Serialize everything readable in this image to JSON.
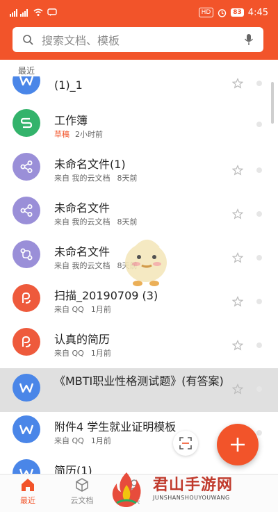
{
  "statusbar": {
    "hd_badge": "HD",
    "battery": "83",
    "time": "4:45"
  },
  "search": {
    "placeholder": "搜索文档、模板"
  },
  "section": {
    "recent_label": "最近"
  },
  "items": [
    {
      "title": "(1)_1",
      "icon": "word-doc-icon",
      "color": "#4a86e8"
    },
    {
      "title": "工作簿",
      "draft": "草稿",
      "time": "2小时前",
      "icon": "sheet-icon",
      "color": "#33b36b"
    },
    {
      "title": "未命名文件(1)",
      "source": "来自 我的云文档",
      "time": "8天前",
      "icon": "share-node-icon",
      "color": "#9a8fd8"
    },
    {
      "title": "未命名文件",
      "source": "来自 我的云文档",
      "time": "8天前",
      "icon": "share-node-icon",
      "color": "#9a8fd8"
    },
    {
      "title": "未命名文件",
      "source": "来自 我的云文档",
      "time": "8天前",
      "icon": "flowchart-icon",
      "color": "#9a8fd8"
    },
    {
      "title": "扫描_20190709 (3)",
      "source": "来自 QQ",
      "time": "1月前",
      "icon": "pdf-icon",
      "color": "#ee5a3c"
    },
    {
      "title": "认真的简历",
      "source": "来自 QQ",
      "time": "1月前",
      "icon": "pdf-icon",
      "color": "#ee5a3c"
    },
    {
      "title": "《MBTI职业性格测试题》(有答案)",
      "icon": "word-doc-icon",
      "color": "#4a86e8"
    },
    {
      "title": "附件4 学生就业证明模板",
      "source": "来自 QQ",
      "time": "1月前",
      "icon": "word-doc-icon",
      "color": "#4a86e8"
    },
    {
      "title": "简历(1)",
      "icon": "word-doc-icon",
      "color": "#4a86e8"
    }
  ],
  "tabs": [
    {
      "label": "最近",
      "active": true
    },
    {
      "label": "云文档",
      "active": false
    },
    {
      "label": "共",
      "active": false
    }
  ],
  "watermark": {
    "title": "君山手游网",
    "subtitle": "JUNSHANSHOUYOUWANG"
  },
  "colors": {
    "accent": "#f2542a"
  }
}
